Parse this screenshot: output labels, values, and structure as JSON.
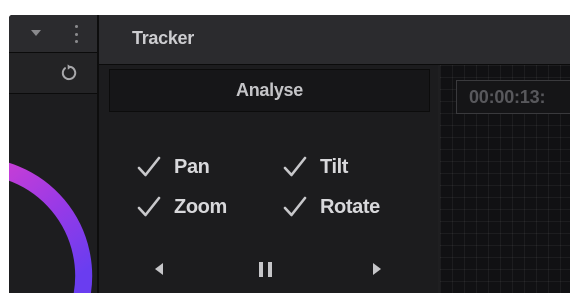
{
  "left_panel": {
    "header": {
      "dropdown_icon": "chevron-down-icon",
      "menu_icon": "kebab-icon"
    },
    "toolbar": {
      "reset_icon": "reset-icon"
    },
    "color_wheel": {
      "ring_colors": [
        "#d63fd0",
        "#9a3ae6",
        "#6a3df0"
      ]
    }
  },
  "tracker": {
    "title": "Tracker",
    "analyse_label": "Analyse",
    "options": [
      {
        "label": "Pan",
        "checked": true
      },
      {
        "label": "Tilt",
        "checked": true
      },
      {
        "label": "Zoom",
        "checked": true
      },
      {
        "label": "Rotate",
        "checked": true
      }
    ],
    "transport": {
      "back_icon": "play-reverse-icon",
      "pause_icon": "pause-icon",
      "forward_icon": "play-forward-icon"
    },
    "graph": {
      "timecode": "00:00:13:"
    }
  },
  "colors": {
    "panel_bg": "#1f1f21",
    "header_bg": "#2b2b2e",
    "text": "#d8d8db"
  }
}
